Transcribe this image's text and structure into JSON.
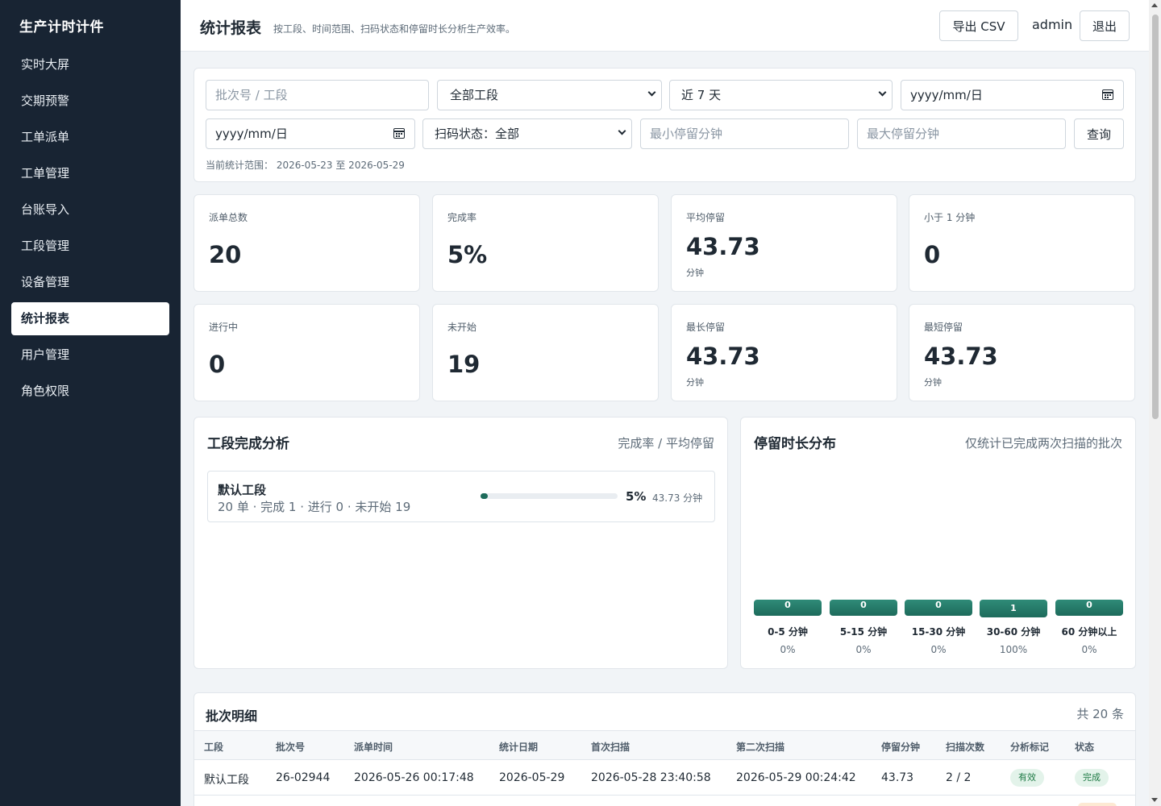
{
  "app": {
    "brand": "生产计时计件"
  },
  "sidebar": {
    "items": [
      {
        "label": "实时大屏",
        "active": false
      },
      {
        "label": "交期预警",
        "active": false
      },
      {
        "label": "工单派单",
        "active": false
      },
      {
        "label": "工单管理",
        "active": false
      },
      {
        "label": "台账导入",
        "active": false
      },
      {
        "label": "工段管理",
        "active": false
      },
      {
        "label": "设备管理",
        "active": false
      },
      {
        "label": "统计报表",
        "active": true
      },
      {
        "label": "用户管理",
        "active": false
      },
      {
        "label": "角色权限",
        "active": false
      }
    ]
  },
  "header": {
    "title": "统计报表",
    "subtitle": "按工段、时间范围、扫码状态和停留时长分析生产效率。",
    "export_label": "导出 CSV",
    "user": "admin",
    "logout_label": "退出"
  },
  "filters": {
    "batch_placeholder": "批次号 / 工段",
    "stage_value": "全部工段",
    "range_value": "近 7 天",
    "start_date_placeholder": "yyyy/mm/日",
    "end_date_placeholder": "yyyy/mm/日",
    "scan_status_value": "扫码状态：全部",
    "min_dwell_placeholder": "最小停留分钟",
    "max_dwell_placeholder": "最大停留分钟",
    "query_label": "查询",
    "range_text": "当前统计范围： 2026-05-23 至 2026-05-29"
  },
  "metrics": [
    {
      "label": "派单总数",
      "value": "20",
      "unit": ""
    },
    {
      "label": "完成率",
      "value": "5%",
      "unit": ""
    },
    {
      "label": "平均停留",
      "value": "43.73",
      "unit": "分钟"
    },
    {
      "label": "小于 1 分钟",
      "value": "0",
      "unit": ""
    },
    {
      "label": "进行中",
      "value": "0",
      "unit": ""
    },
    {
      "label": "未开始",
      "value": "19",
      "unit": ""
    },
    {
      "label": "最长停留",
      "value": "43.73",
      "unit": "分钟"
    },
    {
      "label": "最短停留",
      "value": "43.73",
      "unit": "分钟"
    }
  ],
  "stage_analysis": {
    "title": "工段完成分析",
    "right_label": "完成率 / 平均停留",
    "rows": [
      {
        "name": "默认工段",
        "detail": "20 单 · 完成 1 · 进行 0 · 未开始 19",
        "rate": "5%",
        "rate_value": 0.05,
        "avg": "43.73 分钟"
      }
    ]
  },
  "distribution": {
    "title": "停留时长分布",
    "right_label": "仅统计已完成两次扫描的批次",
    "buckets": [
      {
        "label": "0-5 分钟",
        "count": "0",
        "pct": "0%"
      },
      {
        "label": "5-15 分钟",
        "count": "0",
        "pct": "0%"
      },
      {
        "label": "15-30 分钟",
        "count": "0",
        "pct": "0%"
      },
      {
        "label": "30-60 分钟",
        "count": "1",
        "pct": "100%"
      },
      {
        "label": "60 分钟以上",
        "count": "0",
        "pct": "0%"
      }
    ]
  },
  "table": {
    "title": "批次明细",
    "count": "共 20 条",
    "headers": [
      "工段",
      "批次号",
      "派单时间",
      "统计日期",
      "首次扫描",
      "第二次扫描",
      "停留分钟",
      "扫描次数",
      "分析标记",
      "状态"
    ],
    "rows": [
      [
        "默认工段",
        "26-02944",
        "2026-05-26 00:17:48",
        "2026-05-29",
        "2026-05-28 23:40:58",
        "2026-05-29 00:24:42",
        "43.73",
        "2 / 2",
        "有效",
        "完成"
      ]
    ]
  },
  "colors": {
    "sidebar_bg": "#182433",
    "accent": "#1d6b5b",
    "badge_bg": "#e3f3ea",
    "badge_text": "#1f7a45"
  }
}
